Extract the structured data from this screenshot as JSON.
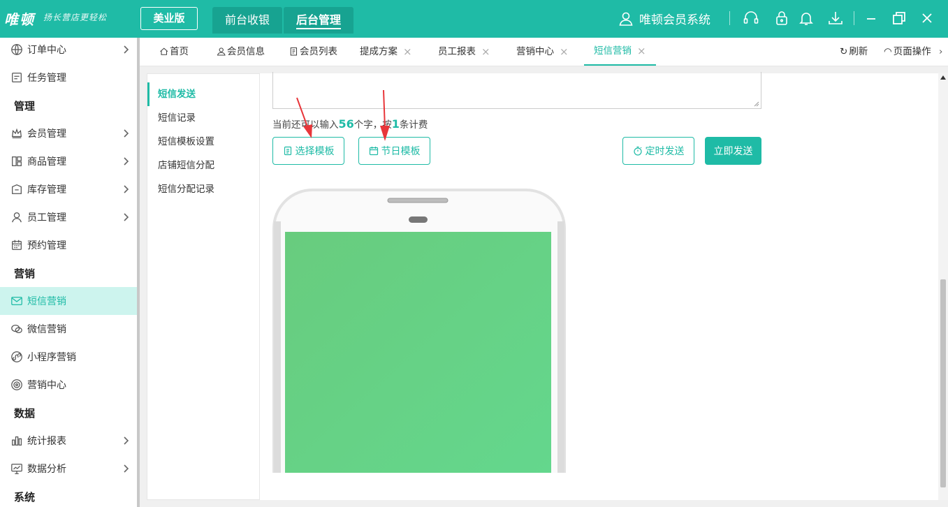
{
  "app": {
    "logo": "唯顿",
    "slogan": "扬长营店更轻松",
    "edition": "美业版",
    "modules": [
      "前台收银",
      "后台管理"
    ],
    "system_name": "唯顿会员系统"
  },
  "sidebar": {
    "items": [
      {
        "label": "订单中心",
        "icon": "globe-icon",
        "arrow": true
      },
      {
        "label": "任务管理",
        "icon": "task-icon",
        "arrow": false
      },
      {
        "heading": "管理"
      },
      {
        "label": "会员管理",
        "icon": "crown-icon",
        "arrow": true
      },
      {
        "label": "商品管理",
        "icon": "goods-icon",
        "arrow": true
      },
      {
        "label": "库存管理",
        "icon": "inventory-icon",
        "arrow": true
      },
      {
        "label": "员工管理",
        "icon": "user-icon",
        "arrow": true
      },
      {
        "label": "预约管理",
        "icon": "calendar-icon",
        "arrow": false
      },
      {
        "heading": "营销"
      },
      {
        "label": "短信营销",
        "icon": "mail-icon",
        "arrow": false,
        "selected": true
      },
      {
        "label": "微信营销",
        "icon": "wechat-icon",
        "arrow": false
      },
      {
        "label": "小程序营销",
        "icon": "miniapp-icon",
        "arrow": false
      },
      {
        "label": "营销中心",
        "icon": "target-icon",
        "arrow": false
      },
      {
        "heading": "数据"
      },
      {
        "label": "统计报表",
        "icon": "bar-chart-icon",
        "arrow": true
      },
      {
        "label": "数据分析",
        "icon": "analysis-icon",
        "arrow": true
      },
      {
        "heading": "系统"
      }
    ]
  },
  "tabs": {
    "items": [
      {
        "label": "首页",
        "icon": "home-icon",
        "closable": false
      },
      {
        "label": "会员信息",
        "icon": "person-icon",
        "closable": false
      },
      {
        "label": "会员列表",
        "icon": "list-icon",
        "closable": false
      },
      {
        "label": "提成方案",
        "closable": true
      },
      {
        "label": "员工报表",
        "closable": true
      },
      {
        "label": "营销中心",
        "closable": true
      },
      {
        "label": "短信营销",
        "closable": true,
        "active": true
      }
    ],
    "refresh": "刷新",
    "page_ops": "页面操作"
  },
  "submenu": [
    "短信发送",
    "短信记录",
    "短信模板设置",
    "店铺短信分配",
    "短信分配记录"
  ],
  "sms": {
    "hint_prefix": "当前还可以输入",
    "remaining": "56",
    "hint_mid": "个字，按",
    "count": "1",
    "hint_suffix": "条计费",
    "choose_template": "选择模板",
    "holiday_template": "节日模板",
    "schedule_send": "定时发送",
    "send_now": "立即发送"
  },
  "colors": {
    "accent": "#1fbba6",
    "screen": "#66cf85",
    "arrow": "#e8363a"
  }
}
